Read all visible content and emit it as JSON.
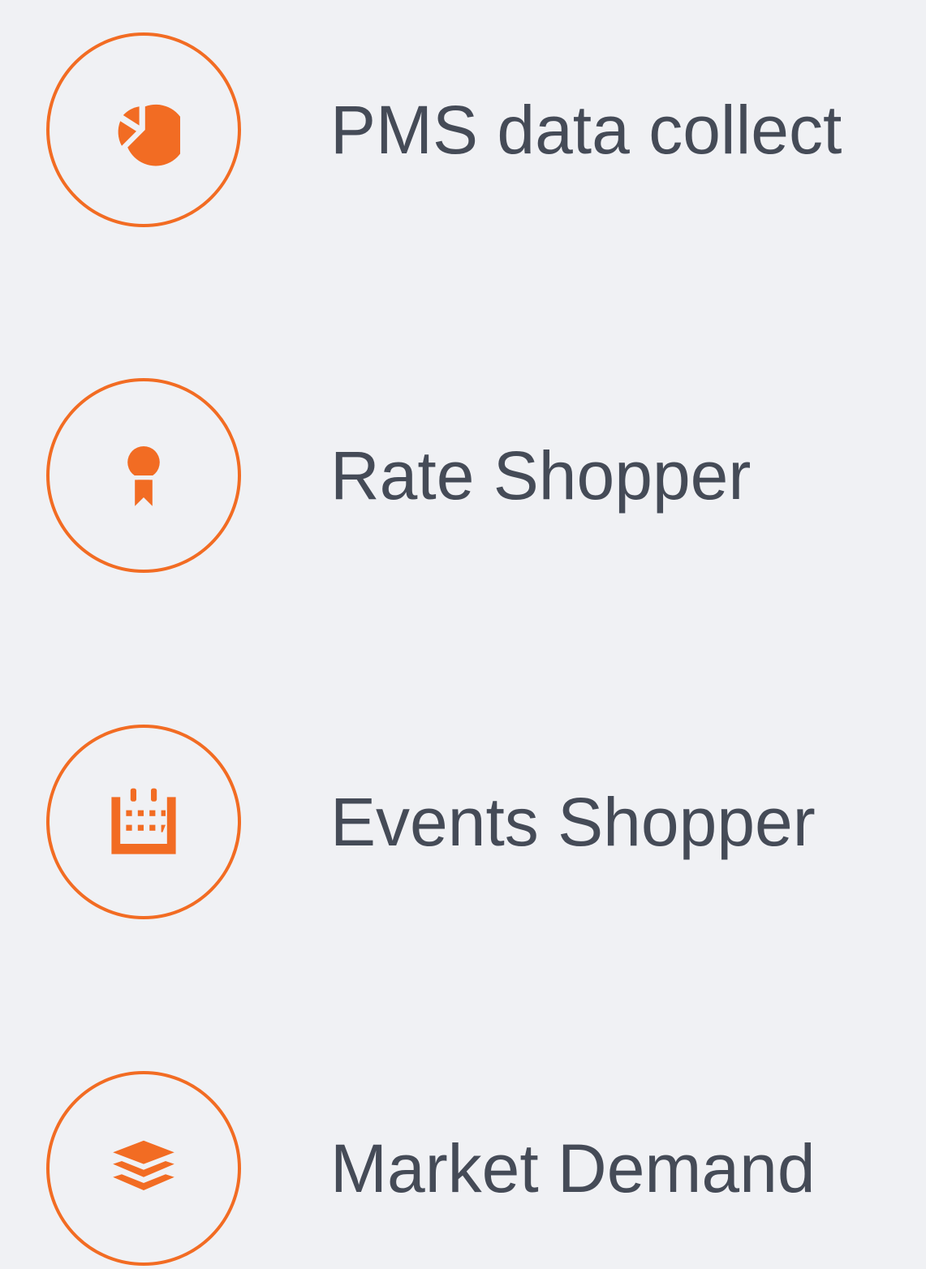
{
  "colors": {
    "accent": "#f26c23",
    "text": "#454b57",
    "background": "#f0f1f4"
  },
  "features": [
    {
      "label": "PMS data collect",
      "icon": "pie-chart-icon"
    },
    {
      "label": "Rate Shopper",
      "icon": "award-ribbon-icon"
    },
    {
      "label": "Events Shopper",
      "icon": "calendar-icon"
    },
    {
      "label": "Market Demand",
      "icon": "layers-icon"
    }
  ]
}
